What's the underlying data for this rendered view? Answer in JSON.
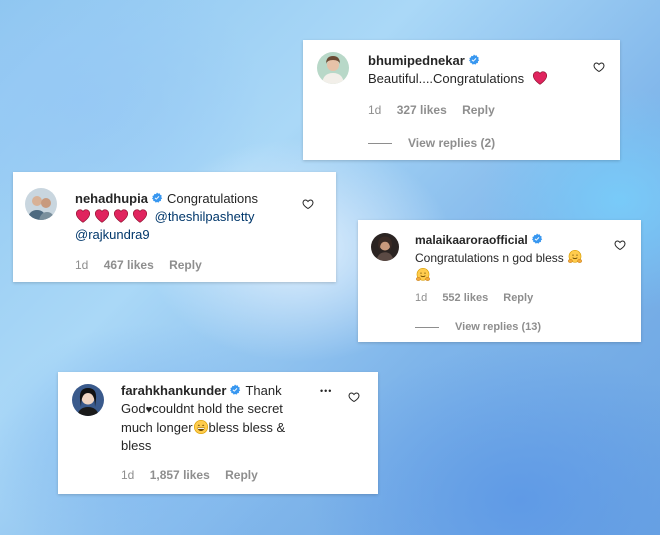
{
  "comments": [
    {
      "username": "bhumipednekar",
      "text": "Beautiful....Congratulations",
      "time": "1d",
      "likes": "327 likes",
      "reply": "Reply",
      "view_replies": "View replies (2)"
    },
    {
      "username": "nehadhupia",
      "text": "Congratulations",
      "mention1": "@theshilpashetty",
      "mention2": "@rajkundra9",
      "time": "1d",
      "likes": "467 likes",
      "reply": "Reply"
    },
    {
      "username": "malaikaaroraofficial",
      "text": "Congratulations n god bless",
      "time": "1d",
      "likes": "552 likes",
      "reply": "Reply",
      "view_replies": "View replies (13)"
    },
    {
      "username": "farahkhankunder",
      "text_part1": "Thank God",
      "text_part2": "couldnt hold the secret much longer",
      "text_part3": "bless bless & bless",
      "time": "1d",
      "likes": "1,857 likes",
      "reply": "Reply",
      "more": "•••"
    }
  ],
  "colors": {
    "verified": "#3897f0",
    "heart_emoji": "#e0245e",
    "meta_text": "#8e8e8e",
    "mention": "#00376b"
  },
  "icons": [
    "verified-badge-icon",
    "like-heart-icon",
    "red-heart-emoji-icon",
    "hugging-face-emoji-icon",
    "grinning-face-emoji-icon",
    "more-options-icon"
  ]
}
